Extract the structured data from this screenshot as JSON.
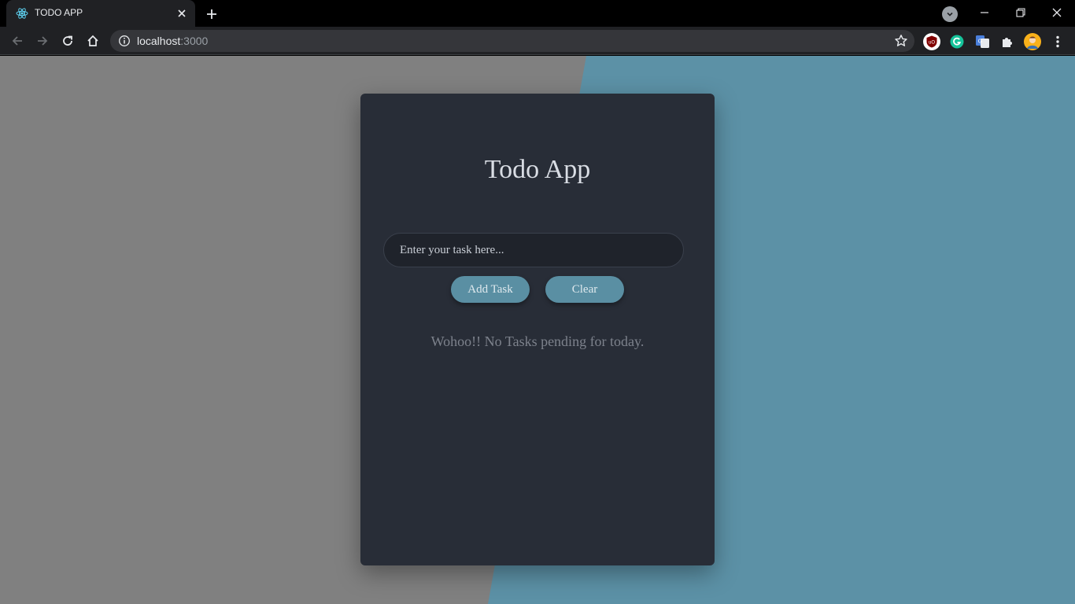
{
  "browser": {
    "tab_title": "TODO APP",
    "url_host": "localhost",
    "url_port": ":3000"
  },
  "app": {
    "title": "Todo App",
    "input_placeholder": "Enter your task here...",
    "add_button_label": "Add Task",
    "clear_button_label": "Clear",
    "empty_message": "Wohoo!! No Tasks pending for today."
  },
  "colors": {
    "page_left": "#808080",
    "page_right": "#5c91a6",
    "card": "#282d37",
    "button": "#5a8fa3"
  },
  "icons": {
    "tab_favicon": "react-icon",
    "extensions": [
      "ublock-origin-icon",
      "grammarly-icon",
      "google-translate-icon",
      "puzzle-extensions-icon",
      "profile-avatar-icon"
    ]
  }
}
